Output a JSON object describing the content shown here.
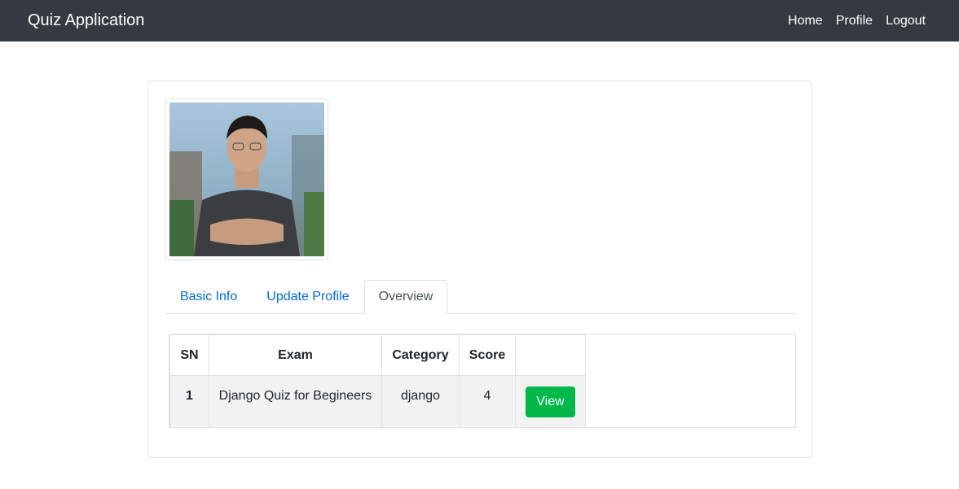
{
  "navbar": {
    "brand": "Quiz Application",
    "links": [
      {
        "label": "Home"
      },
      {
        "label": "Profile"
      },
      {
        "label": "Logout"
      }
    ]
  },
  "profile": {
    "avatar": "profile-photo"
  },
  "tabs": [
    {
      "label": "Basic Info",
      "active": false
    },
    {
      "label": "Update Profile",
      "active": false
    },
    {
      "label": "Overview",
      "active": true
    }
  ],
  "results_table": {
    "headers": [
      "SN",
      "Exam",
      "Category",
      "Score",
      ""
    ],
    "rows": [
      {
        "sn": "1",
        "exam": "Django Quiz for Begineers",
        "category": "django",
        "score": "4",
        "action": "View"
      }
    ]
  },
  "colors": {
    "navbar_bg": "#343a40",
    "link": "#0069d9",
    "view_button": "#00b849"
  }
}
